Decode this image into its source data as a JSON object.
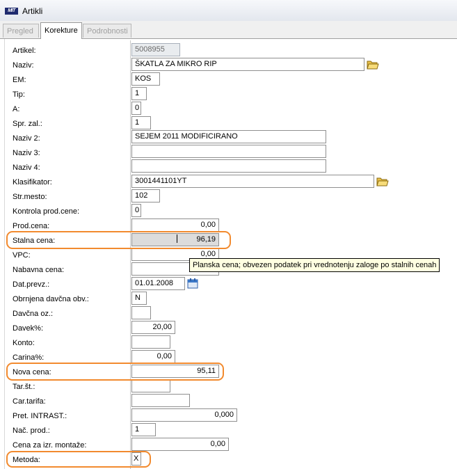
{
  "window": {
    "logo_text": "MIT",
    "title": "Artikli"
  },
  "tabs": [
    "Pregled",
    "Korekture",
    "Podrobnosti"
  ],
  "fields": {
    "artikel": {
      "label": "Artikel:",
      "value": "5008955"
    },
    "naziv": {
      "label": "Naziv:",
      "value": "ŠKATLA ZA MIKRO  RIP"
    },
    "em": {
      "label": "EM:",
      "value": "KOS"
    },
    "tip": {
      "label": "Tip:",
      "value": "1"
    },
    "a": {
      "label": "A:",
      "value": "0"
    },
    "spr_zal": {
      "label": "Spr. zal.:",
      "value": "1"
    },
    "naziv2": {
      "label": "Naziv 2:",
      "value": "SEJEM 2011 MODIFICIRANO"
    },
    "naziv3": {
      "label": "Naziv 3:",
      "value": ""
    },
    "naziv4": {
      "label": "Naziv 4:",
      "value": ""
    },
    "klasifikator": {
      "label": "Klasifikator:",
      "value": "3001441101YT"
    },
    "str_mesto": {
      "label": "Str.mesto:",
      "value": "102"
    },
    "kontrola_prod_cene": {
      "label": "Kontrola prod.cene:",
      "value": "0"
    },
    "prod_cena": {
      "label": "Prod.cena:",
      "value": "0,00"
    },
    "stalna_cena": {
      "label": "Stalna cena:",
      "value": "96,19"
    },
    "vpc": {
      "label": "VPC:",
      "value": "0,00"
    },
    "nabavna_cena": {
      "label": "Nabavna cena:",
      "value": ""
    },
    "dat_prevz": {
      "label": "Dat.prevz.:",
      "value": "01.01.2008"
    },
    "obrnjena_davcna": {
      "label": "Obrnjena davčna obv.:",
      "value": "N"
    },
    "davcna_oz": {
      "label": "Davčna oz.:",
      "value": ""
    },
    "davek": {
      "label": "Davek%:",
      "value": "20,00"
    },
    "konto": {
      "label": "Konto:",
      "value": ""
    },
    "carina": {
      "label": "Carina%:",
      "value": "0,00"
    },
    "nova_cena": {
      "label": "Nova cena:",
      "value": "95,11"
    },
    "tar_st": {
      "label": "Tar.št.:",
      "value": ""
    },
    "car_tarifa": {
      "label": "Car.tarifa:",
      "value": ""
    },
    "pret_intrast": {
      "label": "Pret. INTRAST.:",
      "value": "0,000"
    },
    "nac_prod": {
      "label": "Nač. prod.:",
      "value": "1"
    },
    "cena_montaze": {
      "label": "Cena za izr. montaže:",
      "value": "0,00"
    },
    "metoda": {
      "label": "Metoda:",
      "value": "X"
    }
  },
  "tooltip": "Planska cena; obvezen podatek pri vrednotenju zaloge po stalnih cenah",
  "colors": {
    "highlight": "#f28a2e",
    "tooltip_bg": "#ffffe1"
  },
  "icons": [
    "folder-icon",
    "calendar-icon",
    "app-logo"
  ]
}
